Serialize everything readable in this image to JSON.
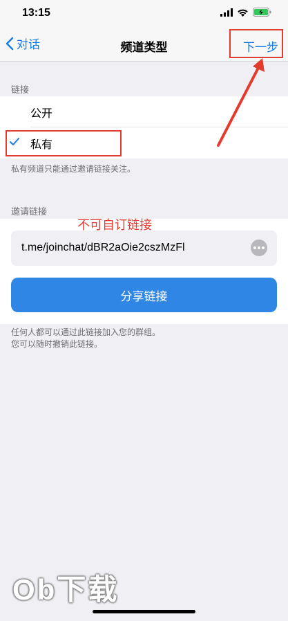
{
  "status": {
    "time": "13:15"
  },
  "nav": {
    "back_label": "对话",
    "title": "频道类型",
    "next_label": "下一步"
  },
  "link_section": {
    "header": "链接",
    "options": [
      "公开",
      "私有"
    ],
    "selected": "私有",
    "hint": "私有频道只能通过邀请链接关注。"
  },
  "invite_section": {
    "header": "邀请链接",
    "annotation": "不可自订链接",
    "link": "t.me/joinchat/dBR2aOie2cszMzFl",
    "share_label": "分享链接",
    "hint_lines": [
      "任何人都可以通过此链接加入您的群组。",
      "您可以随时撤销此链接。"
    ]
  },
  "watermark": "Ob下载",
  "colors": {
    "accent": "#1a7ce5",
    "button": "#2f86e4",
    "annotation": "#e33b2e",
    "background": "#efeff4"
  },
  "icons": [
    "signal-icon",
    "wifi-icon",
    "battery-icon",
    "back-chevron-icon",
    "checkmark-icon",
    "more-icon",
    "annotation-arrow-icon"
  ]
}
